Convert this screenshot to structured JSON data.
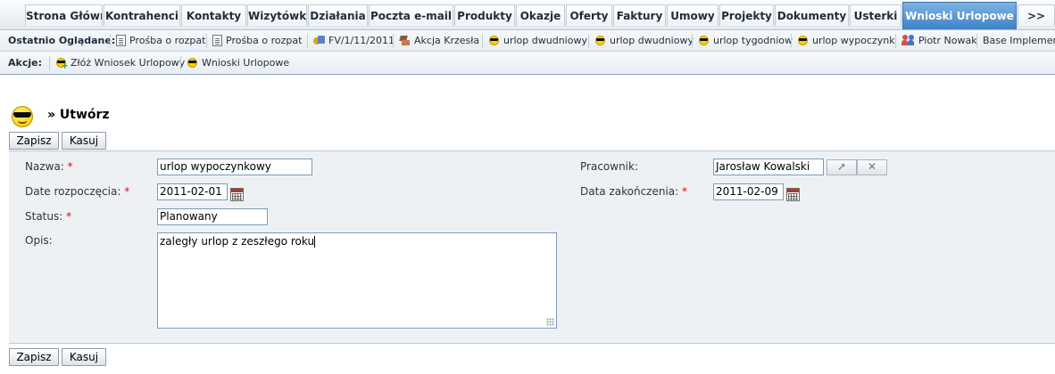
{
  "tabs": [
    {
      "label": "Strona Główna"
    },
    {
      "label": "Kontrahenci"
    },
    {
      "label": "Kontakty"
    },
    {
      "label": "Wizytówki"
    },
    {
      "label": "Działania"
    },
    {
      "label": "Poczta e-mail"
    },
    {
      "label": "Produkty"
    },
    {
      "label": "Okazje"
    },
    {
      "label": "Oferty"
    },
    {
      "label": "Faktury"
    },
    {
      "label": "Umowy"
    },
    {
      "label": "Projekty"
    },
    {
      "label": "Dokumenty"
    },
    {
      "label": "Usterki"
    },
    {
      "label": "Wnioski Urlopowe",
      "active": true
    },
    {
      "label": ">>"
    }
  ],
  "recent": {
    "label": "Ostatnio Oglądane:",
    "items": [
      {
        "label": "Prośba o rozpat",
        "icon": "document-icon"
      },
      {
        "label": "Prośba o rozpat",
        "icon": "document-icon"
      },
      {
        "label": "FV/1/11/2011",
        "icon": "invoice-icon"
      },
      {
        "label": "Akcja Krzesła",
        "icon": "chair-icon"
      },
      {
        "label": "urlop dwudniowy",
        "icon": "sun-icon"
      },
      {
        "label": "urlop dwudniowy",
        "icon": "sun-icon"
      },
      {
        "label": "urlop tygodniow",
        "icon": "sun-icon"
      },
      {
        "label": "urlop wypoczynk",
        "icon": "sun-icon"
      },
      {
        "label": "Piotr Nowak",
        "icon": "users-icon"
      },
      {
        "label": "Base Implementa",
        "icon": ""
      }
    ]
  },
  "actions": {
    "label": "Akcje:",
    "items": [
      {
        "label": "Złóż Wniosek Urlopowy",
        "icon": "sun-plus-icon"
      },
      {
        "label": "Wnioski Urlopowe",
        "icon": "sun-icon"
      }
    ]
  },
  "page": {
    "title": "» Utwórz",
    "icon": "sunglasses-sun-icon"
  },
  "buttons": {
    "save": "Zapisz",
    "cancel": "Kasuj"
  },
  "form": {
    "name_label": "Nazwa:",
    "name_value": "urlop wypoczynkowy",
    "start_label": "Date rozpoczęcia:",
    "start_value": "2011-02-01",
    "status_label": "Status:",
    "status_value": "Planowany",
    "desc_label": "Opis:",
    "desc_value": "zaległy urlop z zeszłego roku",
    "employee_label": "Pracownik:",
    "employee_value": "Jarosław Kowalski",
    "end_label": "Data zakończenia:",
    "end_value": "2011-02-09",
    "required_marker": "*"
  },
  "colors": {
    "active_tab": "#3f82c7",
    "required": "#d01010",
    "panel": "#eef1f4"
  }
}
